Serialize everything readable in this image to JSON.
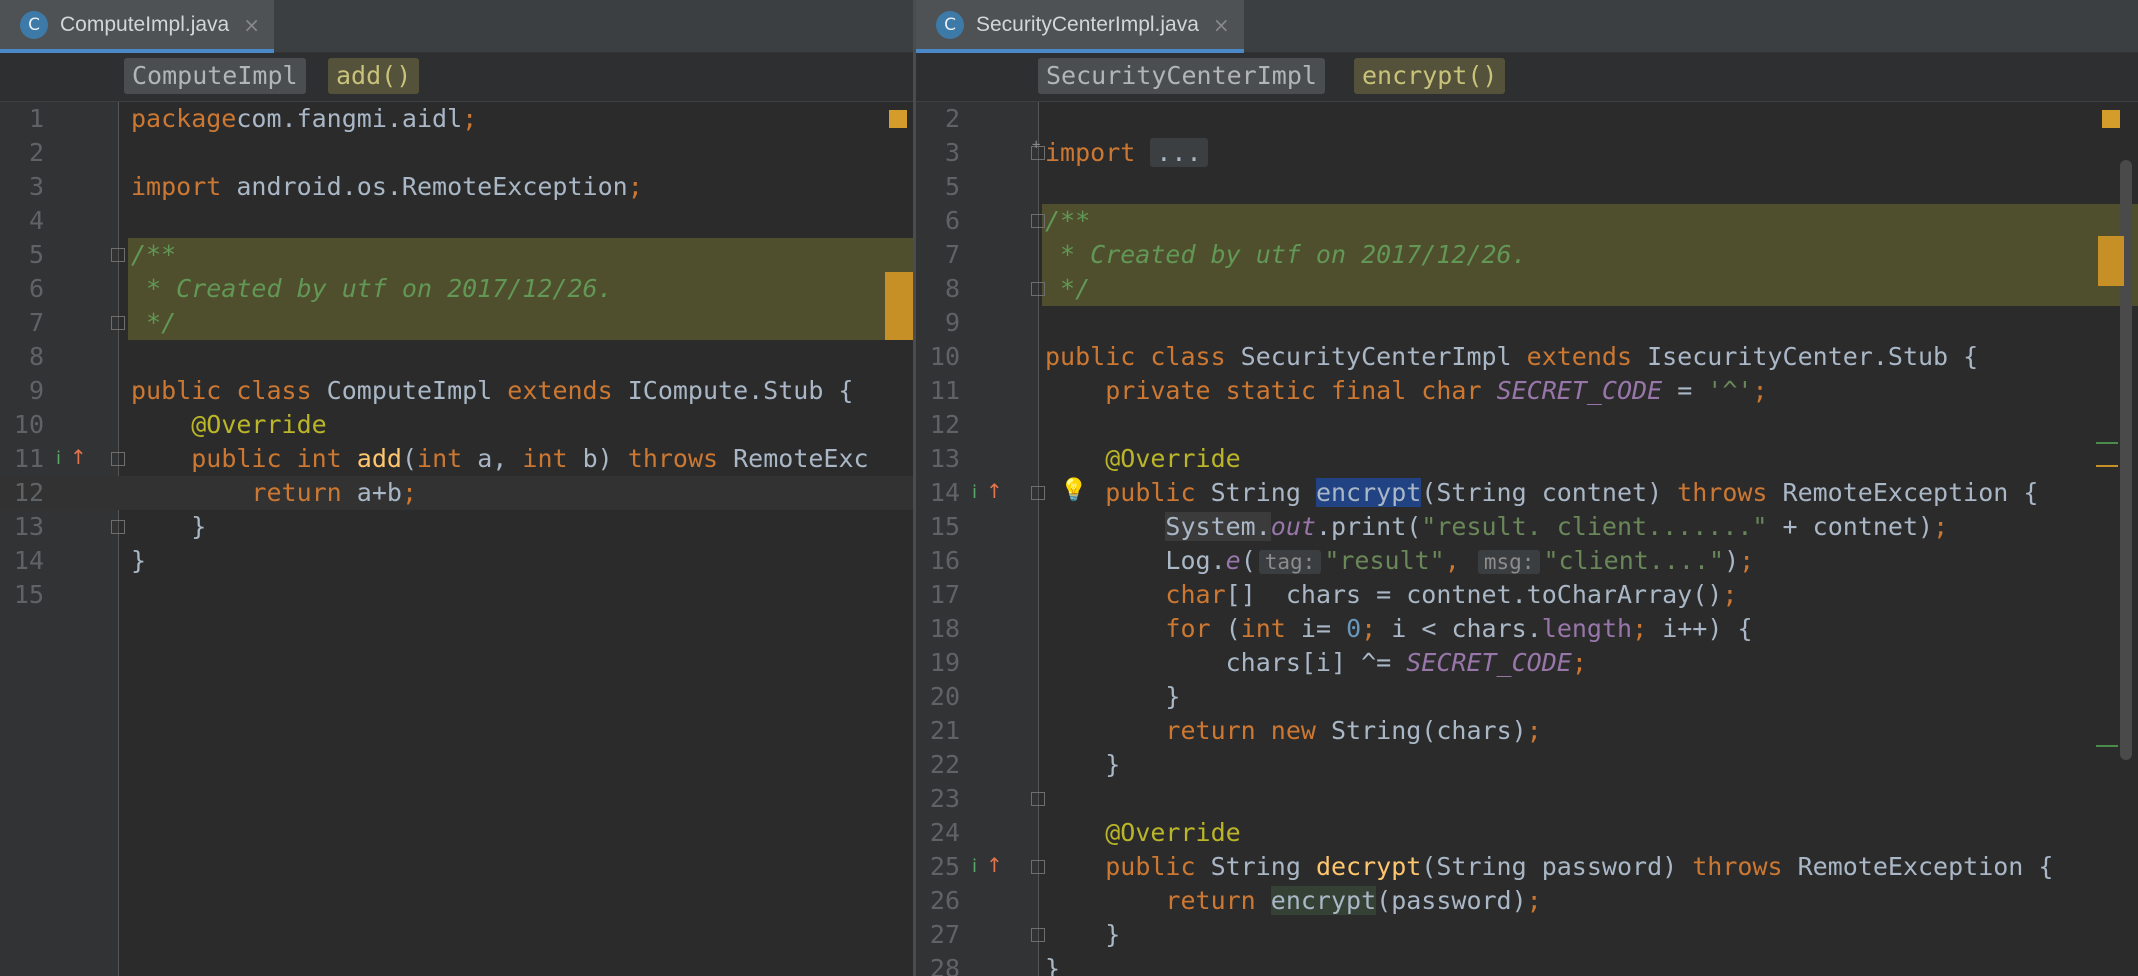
{
  "left": {
    "tab": {
      "icon_letter": "C",
      "title": "ComputeImpl.java",
      "close": "×"
    },
    "breadcrumb": {
      "class_name": "ComputeImpl",
      "method": "add()"
    }
  },
  "right": {
    "tab": {
      "icon_letter": "C",
      "title": "SecurityCenterImpl.java",
      "close": "×"
    },
    "breadcrumb": {
      "class_name": "SecurityCenterImpl",
      "method": "encrypt()"
    }
  },
  "left_code": [
    {
      "n": "1",
      "t": [
        [
          "pk",
          "package"
        ],
        [
          "",
          "com.fangmi.aidl"
        ],
        [
          "kw",
          ";"
        ]
      ]
    },
    {
      "n": "2",
      "t": []
    },
    {
      "n": "3",
      "t": [
        [
          "kw",
          "import "
        ],
        [
          "",
          "android.os.RemoteException"
        ],
        [
          "kw",
          ";"
        ]
      ]
    },
    {
      "n": "4",
      "t": []
    },
    {
      "n": "5",
      "t": [
        [
          "cmt",
          "/**"
        ]
      ]
    },
    {
      "n": "6",
      "t": [
        [
          "cmt",
          " * Created by utf on 2017/12/26."
        ]
      ]
    },
    {
      "n": "7",
      "t": [
        [
          "cmt",
          " */"
        ]
      ]
    },
    {
      "n": "8",
      "t": []
    },
    {
      "n": "9",
      "t": [
        [
          "kw",
          "public class "
        ],
        [
          "",
          "ComputeImpl "
        ],
        [
          "kw",
          "extends "
        ],
        [
          "",
          "ICompute.Stub {"
        ]
      ]
    },
    {
      "n": "10",
      "t": [
        [
          "",
          "    "
        ],
        [
          "ann",
          "@Override"
        ]
      ]
    },
    {
      "n": "11",
      "t": [
        [
          "",
          "    "
        ],
        [
          "kw",
          "public int "
        ],
        [
          "fn",
          "add"
        ],
        [
          "",
          "("
        ],
        [
          "kw",
          "int "
        ],
        [
          "",
          "a, "
        ],
        [
          "kw",
          "int "
        ],
        [
          "",
          "b) "
        ],
        [
          "kw",
          "throws "
        ],
        [
          "",
          "RemoteExc"
        ]
      ]
    },
    {
      "n": "12",
      "t": [
        [
          "",
          "        "
        ],
        [
          "kw",
          "return "
        ],
        [
          "",
          "a+b"
        ],
        [
          "kw",
          ";"
        ]
      ]
    },
    {
      "n": "13",
      "t": [
        [
          "",
          "    }"
        ]
      ]
    },
    {
      "n": "14",
      "t": [
        [
          "",
          "}"
        ]
      ]
    },
    {
      "n": "15",
      "t": []
    }
  ],
  "right_code": [
    {
      "n": "2",
      "t": []
    },
    {
      "n": "3",
      "t": [
        [
          "kw",
          "import "
        ],
        [
          "ellipsis",
          "..."
        ]
      ]
    },
    {
      "n": "5",
      "t": []
    },
    {
      "n": "6",
      "t": [
        [
          "cmt",
          "/**"
        ]
      ]
    },
    {
      "n": "7",
      "t": [
        [
          "cmt",
          " * Created by utf on 2017/12/26."
        ]
      ]
    },
    {
      "n": "8",
      "t": [
        [
          "cmt",
          " */"
        ]
      ]
    },
    {
      "n": "9",
      "t": []
    },
    {
      "n": "10",
      "t": [
        [
          "kw",
          "public class "
        ],
        [
          "",
          "SecurityCenterImpl "
        ],
        [
          "kw",
          "extends "
        ],
        [
          "",
          "IsecurityCenter.Stub {"
        ]
      ]
    },
    {
      "n": "11",
      "t": [
        [
          "",
          "    "
        ],
        [
          "kw",
          "private static final char "
        ],
        [
          "cst",
          "SECRET_CODE"
        ],
        [
          "",
          " = "
        ],
        [
          "str",
          "'^'"
        ],
        [
          "kw",
          ";"
        ]
      ]
    },
    {
      "n": "12",
      "t": []
    },
    {
      "n": "13",
      "t": [
        [
          "",
          "    "
        ],
        [
          "ann",
          "@Override"
        ]
      ]
    },
    {
      "n": "14",
      "t": [
        [
          "",
          "    "
        ],
        [
          "kw",
          "public "
        ],
        [
          "",
          "String "
        ],
        [
          "sel",
          "encrypt"
        ],
        [
          "",
          "(String contnet) "
        ],
        [
          "kw",
          "throws "
        ],
        [
          "",
          "RemoteException {"
        ]
      ]
    },
    {
      "n": "15",
      "t": [
        [
          "",
          "        "
        ],
        [
          "sout",
          "System."
        ],
        [
          "mouto",
          "out"
        ],
        [
          "",
          ".print("
        ],
        [
          "str",
          "\"result. client.......\""
        ],
        [
          "",
          " + contnet)"
        ],
        [
          "kw",
          ";"
        ]
      ]
    },
    {
      "n": "16",
      "t": [
        [
          "",
          "        Log."
        ],
        [
          "mouto",
          "e"
        ],
        [
          "",
          "("
        ],
        [
          "hint",
          "tag:"
        ],
        [
          "str",
          "\"result\""
        ],
        [
          "kw",
          ", "
        ],
        [
          "hint",
          "msg:"
        ],
        [
          "str",
          "\"client....\""
        ],
        [
          "",
          ")"
        ],
        [
          "kw",
          ";"
        ]
      ]
    },
    {
      "n": "17",
      "t": [
        [
          "",
          "        "
        ],
        [
          "kw",
          "char"
        ],
        [
          "",
          "[]  chars = contnet.toCharArray()"
        ],
        [
          "kw",
          ";"
        ]
      ]
    },
    {
      "n": "18",
      "t": [
        [
          "",
          "        "
        ],
        [
          "kw",
          "for "
        ],
        [
          "",
          "("
        ],
        [
          "kw",
          "int "
        ],
        [
          "",
          "i= "
        ],
        [
          "num",
          "0"
        ],
        [
          "kw",
          "; "
        ],
        [
          "",
          "i < chars."
        ],
        [
          "fld",
          "length"
        ],
        [
          "kw",
          "; "
        ],
        [
          "",
          "i++) {"
        ]
      ]
    },
    {
      "n": "19",
      "t": [
        [
          "",
          "            chars[i] ^= "
        ],
        [
          "cst",
          "SECRET_CODE"
        ],
        [
          "kw",
          ";"
        ]
      ]
    },
    {
      "n": "20",
      "t": [
        [
          "",
          "        }"
        ]
      ]
    },
    {
      "n": "21",
      "t": [
        [
          "",
          "        "
        ],
        [
          "kw",
          "return new "
        ],
        [
          "",
          "String(chars)"
        ],
        [
          "kw",
          ";"
        ]
      ]
    },
    {
      "n": "22",
      "t": [
        [
          "",
          "    }"
        ]
      ]
    },
    {
      "n": "23",
      "t": []
    },
    {
      "n": "24",
      "t": [
        [
          "",
          "    "
        ],
        [
          "ann",
          "@Override"
        ]
      ]
    },
    {
      "n": "25",
      "t": [
        [
          "",
          "    "
        ],
        [
          "kw",
          "public "
        ],
        [
          "",
          "String "
        ],
        [
          "fn",
          "decrypt"
        ],
        [
          "",
          "(String password) "
        ],
        [
          "kw",
          "throws "
        ],
        [
          "",
          "RemoteException {"
        ]
      ]
    },
    {
      "n": "26",
      "t": [
        [
          "",
          "        "
        ],
        [
          "kw",
          "return "
        ],
        [
          "usage",
          "encrypt"
        ],
        [
          "",
          "(password)"
        ],
        [
          "kw",
          ";"
        ]
      ]
    },
    {
      "n": "27",
      "t": [
        [
          "",
          "    }"
        ]
      ]
    },
    {
      "n": "28",
      "t": [
        [
          "",
          "}"
        ]
      ]
    }
  ],
  "icons": {
    "implemented": "i",
    "override_arrow": "↑",
    "intention_bulb": "💡"
  }
}
